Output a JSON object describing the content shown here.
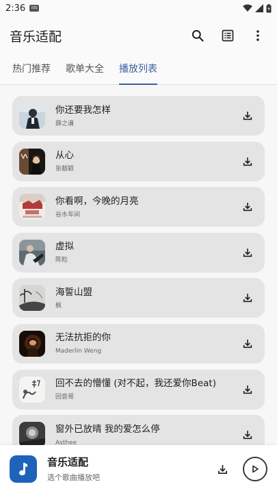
{
  "status": {
    "time": "2:36",
    "chip": "iOS"
  },
  "app_bar": {
    "title": "音乐适配",
    "icons": [
      "search-icon",
      "list-icon",
      "more-vert-icon"
    ]
  },
  "tabs": [
    {
      "label": "热门推荐",
      "active": false
    },
    {
      "label": "歌单大全",
      "active": false
    },
    {
      "label": "播放列表",
      "active": true
    }
  ],
  "songs": [
    {
      "title": "你还要我怎样",
      "artist": "薛之谦"
    },
    {
      "title": "从心",
      "artist": "张靓颖"
    },
    {
      "title": "你看啊，今晚的月亮",
      "artist": "谷水车间"
    },
    {
      "title": "虚拟",
      "artist": "陈粒"
    },
    {
      "title": "海誓山盟",
      "artist": "枫"
    },
    {
      "title": "无法抗拒的你",
      "artist": "Maderlin Weng"
    },
    {
      "title": "回不去的懵懂 (对不起，我还爱你Beat)",
      "artist": "回音哥"
    },
    {
      "title": "窗外已放晴 我的爱怎么停",
      "artist": "Asthee"
    }
  ],
  "player": {
    "title": "音乐适配",
    "subtitle": "选个歌曲播放吧"
  },
  "colors": {
    "accent": "#3b5fa0",
    "player_art": "#1e63b9",
    "card_bg": "#e4e4e4"
  }
}
